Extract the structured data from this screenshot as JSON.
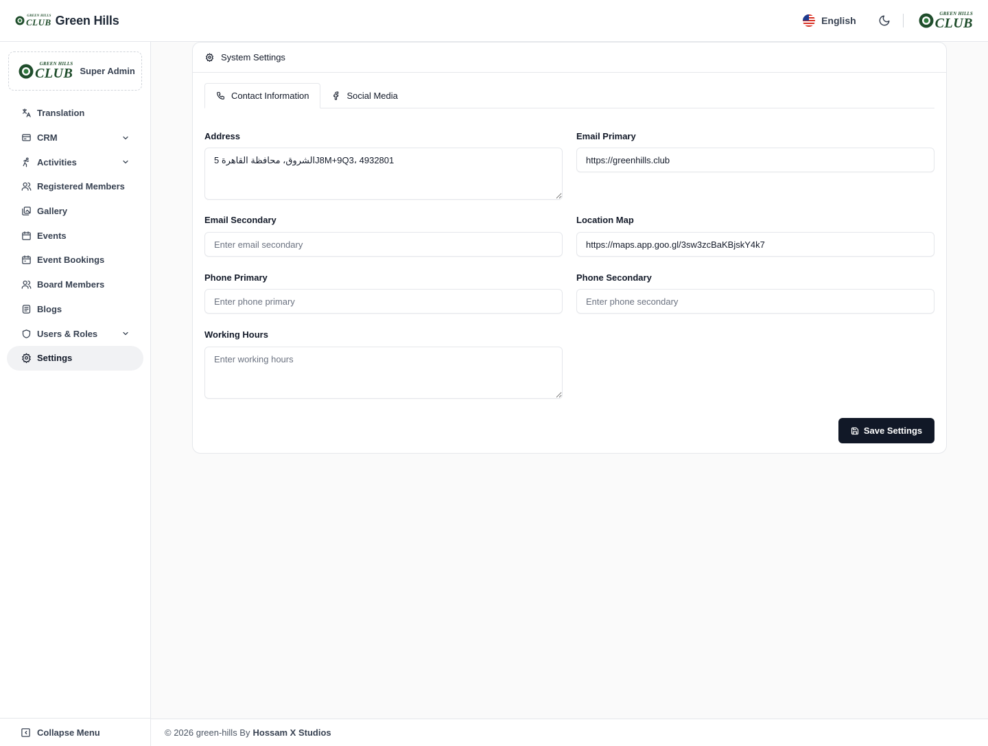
{
  "header": {
    "brand_title": "Green Hills",
    "logo_small": "GREEN HILLS",
    "logo_big": "CLUB",
    "language": "English"
  },
  "sidebar": {
    "profile_role": "Super Admin",
    "items": [
      {
        "label": "Translation",
        "icon": "translate-icon",
        "has_chevron": false
      },
      {
        "label": "CRM",
        "icon": "crm-icon",
        "has_chevron": true
      },
      {
        "label": "Activities",
        "icon": "activity-icon",
        "has_chevron": true
      },
      {
        "label": "Registered Members",
        "icon": "users-icon",
        "has_chevron": false
      },
      {
        "label": "Gallery",
        "icon": "gallery-icon",
        "has_chevron": false
      },
      {
        "label": "Events",
        "icon": "calendar-icon",
        "has_chevron": false
      },
      {
        "label": "Event Bookings",
        "icon": "calendar-icon",
        "has_chevron": false
      },
      {
        "label": "Board Members",
        "icon": "users-icon",
        "has_chevron": false
      },
      {
        "label": "Blogs",
        "icon": "blog-icon",
        "has_chevron": false
      },
      {
        "label": "Users & Roles",
        "icon": "shield-icon",
        "has_chevron": true
      },
      {
        "label": "Settings",
        "icon": "gear-icon",
        "has_chevron": false,
        "active": true
      }
    ],
    "collapse_label": "Collapse Menu"
  },
  "main": {
    "card_title": "System Settings",
    "tabs": [
      {
        "label": "Contact Information",
        "icon": "phone-icon",
        "active": true
      },
      {
        "label": "Social Media",
        "icon": "facebook-icon",
        "active": false
      }
    ],
    "fields": {
      "address": {
        "label": "Address",
        "value": "الشروق، محافظة القاهرة 5J8M+9Q3، 4932801",
        "placeholder": ""
      },
      "email_primary": {
        "label": "Email Primary",
        "value": "https://greenhills.club",
        "placeholder": ""
      },
      "email_secondary": {
        "label": "Email Secondary",
        "value": "",
        "placeholder": "Enter email secondary"
      },
      "location_map": {
        "label": "Location Map",
        "value": "https://maps.app.goo.gl/3sw3zcBaKBjskY4k7",
        "placeholder": ""
      },
      "phone_primary": {
        "label": "Phone Primary",
        "value": "",
        "placeholder": "Enter phone primary"
      },
      "phone_secondary": {
        "label": "Phone Secondary",
        "value": "",
        "placeholder": "Enter phone secondary"
      },
      "working_hours": {
        "label": "Working Hours",
        "value": "",
        "placeholder": "Enter working hours"
      }
    },
    "save_label": "Save Settings"
  },
  "footer": {
    "copyright": "© 2026 green-hills By",
    "company": "Hossam X Studios"
  },
  "colors": {
    "primary_button": "#111827",
    "logo_green": "#1f4d2b",
    "active_nav_bg": "#f1f2f4"
  }
}
